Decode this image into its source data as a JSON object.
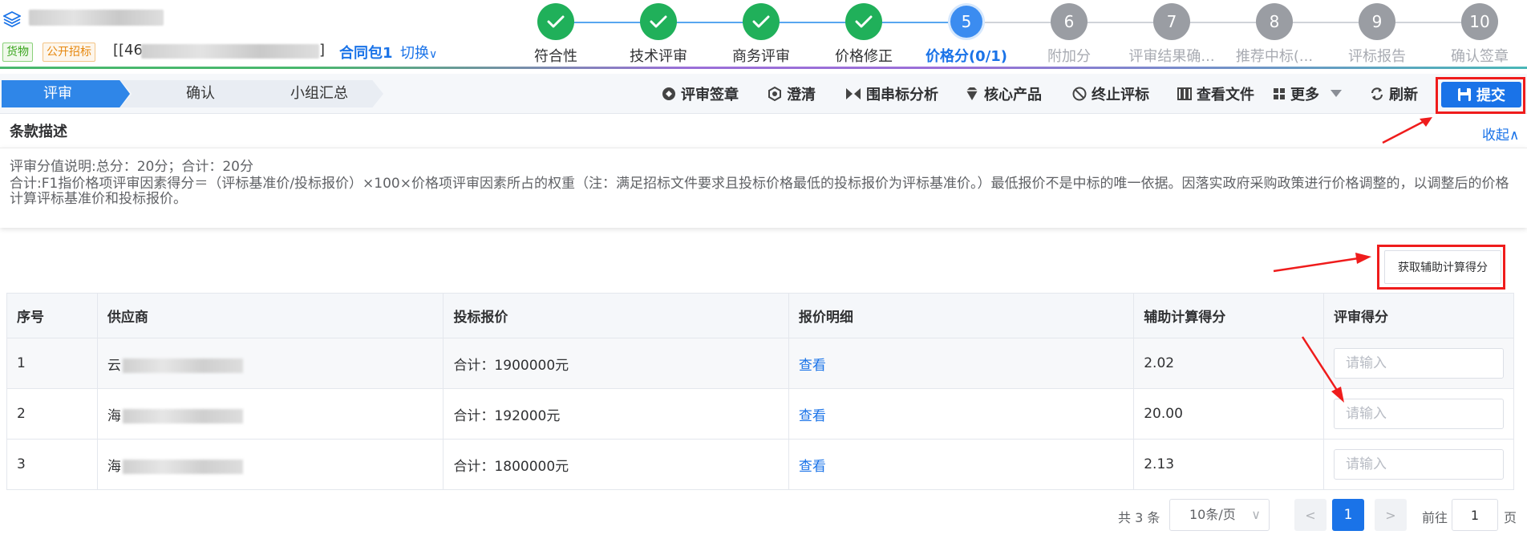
{
  "header": {
    "project_prefix": "[[46",
    "project_bracket": "]",
    "tags": [
      "货物",
      "公开招标"
    ],
    "package_name": "合同包1",
    "switch_label": "切换",
    "steps": [
      {
        "num": "1",
        "label": "符合性",
        "state": "done"
      },
      {
        "num": "2",
        "label": "技术评审",
        "state": "done"
      },
      {
        "num": "3",
        "label": "商务评审",
        "state": "done"
      },
      {
        "num": "4",
        "label": "价格修正",
        "state": "done"
      },
      {
        "num": "5",
        "label": "价格分(0/1)",
        "state": "current"
      },
      {
        "num": "6",
        "label": "附加分",
        "state": "todo"
      },
      {
        "num": "7",
        "label": "评审结果确...",
        "state": "todo"
      },
      {
        "num": "8",
        "label": "推荐中标(...",
        "state": "todo"
      },
      {
        "num": "9",
        "label": "评标报告",
        "state": "todo"
      },
      {
        "num": "10",
        "label": "确认签章",
        "state": "todo"
      }
    ]
  },
  "toolbar": {
    "flow": [
      "评审",
      "确认",
      "小组汇总"
    ],
    "actions": [
      "评审签章",
      "澄清",
      "围串标分析",
      "核心产品",
      "终止评标",
      "查看文件",
      "更多",
      "刷新"
    ],
    "submit": "提交"
  },
  "clause": {
    "title": "条款描述",
    "collapse": "收起",
    "line1": "评审分值说明:总分：20分；合计：20分",
    "line2": "合计:F1指价格项评审因素得分＝（评标基准价/投标报价）×100×价格项评审因素所占的权重（注：满足招标文件要求且投标价格最低的投标报价为评标基准价。）最低报价不是中标的唯一依据。因落实政府采购政策进行价格调整的，以调整后的价格计算评标基准价和投标报价。"
  },
  "aux_button": "获取辅助计算得分",
  "table": {
    "headers": [
      "序号",
      "供应商",
      "投标报价",
      "报价明细",
      "辅助计算得分",
      "评审得分"
    ],
    "rows": [
      {
        "index": "1",
        "supplier_first": "云",
        "price": "合计：1900000元",
        "detail": "查看",
        "aux_score": "2.02",
        "placeholder": "请输入"
      },
      {
        "index": "2",
        "supplier_first": "海",
        "price": "合计：192000元",
        "detail": "查看",
        "aux_score": "20.00",
        "placeholder": "请输入"
      },
      {
        "index": "3",
        "supplier_first": "海",
        "price": "合计：1800000元",
        "detail": "查看",
        "aux_score": "2.13",
        "placeholder": "请输入"
      }
    ]
  },
  "pagination": {
    "total": "共 3 条",
    "page_size": "10条/页",
    "current_page": "1",
    "goto_prefix": "前往",
    "goto_value": "1",
    "goto_suffix": "页"
  },
  "colors": {
    "primary": "#1a73e8",
    "done": "#20b05a",
    "annotation": "#ef1c1c"
  }
}
